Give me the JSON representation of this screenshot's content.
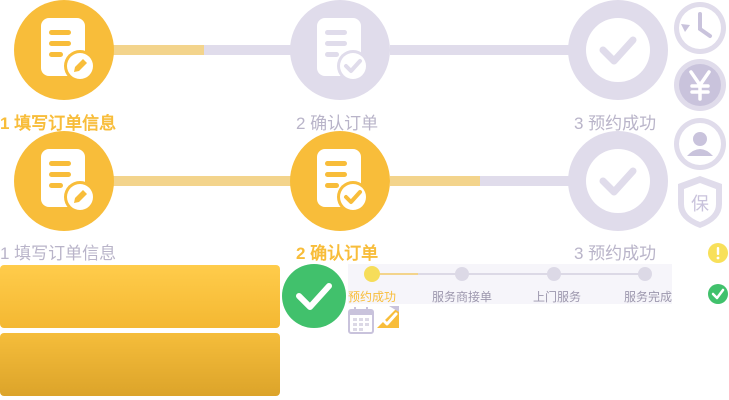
{
  "colors": {
    "active": "#f8bd3a",
    "active_line": "#f3d48c",
    "inactive": "#e0dceb",
    "inactive_icon": "#c9c3dc",
    "green": "#41c16c",
    "warn": "#f8e05a"
  },
  "steps_row1": {
    "step1": "1 填写订单信息",
    "step2": "2 确认订单",
    "step3": "3 预约成功"
  },
  "steps_row2": {
    "step1": "1 填写订单信息",
    "step2": "2 确认订单",
    "step3": "3 预约成功"
  },
  "mini_progress": {
    "labels": [
      "预约成功",
      "服务商接单",
      "上门服务",
      "服务完成"
    ],
    "active_index": 0
  },
  "icons": [
    "clock-icon",
    "yen-icon",
    "user-icon",
    "shield-icon",
    "warning-icon",
    "check-icon",
    "calendar-icon",
    "edit-icon"
  ]
}
